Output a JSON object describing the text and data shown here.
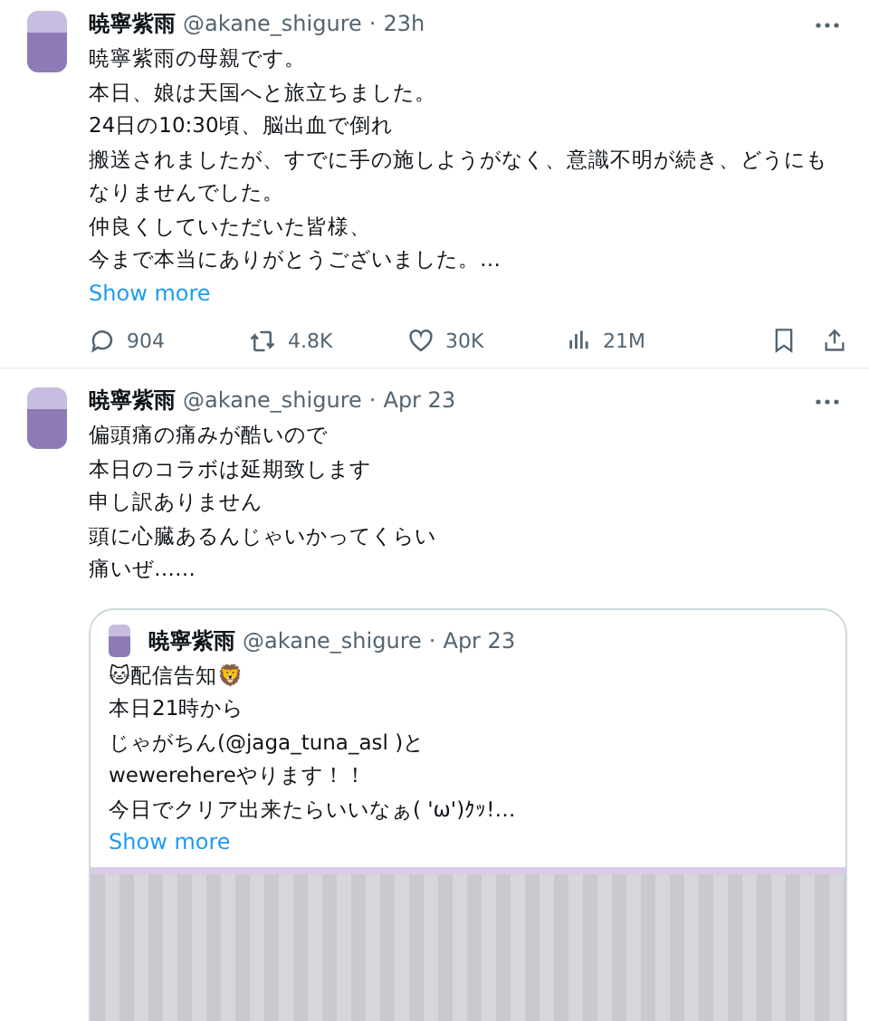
{
  "tweets": [
    {
      "name": "暁寧紫雨",
      "handle": "@akane_shigure",
      "separator": "·",
      "time": "23h",
      "lines": [
        "暁寧紫雨の母親です。",
        "本日、娘は天国へと旅立ちました。",
        "24日の10:30頃、脳出血で倒れ",
        "搬送されましたが、すでに手の施しようがなく、意識不明が続き、どうにもなりませんでした。",
        "仲良くしていただいた皆様、",
        "今まで本当にありがとうございました。…"
      ],
      "show_more": "Show more",
      "stats": {
        "replies": "904",
        "retweets": "4.8K",
        "likes": "30K",
        "views": "21M"
      }
    },
    {
      "name": "暁寧紫雨",
      "handle": "@akane_shigure",
      "separator": "·",
      "time": "Apr 23",
      "lines": [
        "偏頭痛の痛みが酷いので",
        "本日のコラボは延期致します",
        "申し訳ありません",
        "頭に心臓あるんじゃいかってくらい",
        "痛いぜ……"
      ],
      "quote": {
        "name": "暁寧紫雨",
        "handle": "@akane_shigure",
        "separator": "·",
        "time": "Apr 23",
        "lines": [
          "🐱配信告知🦁",
          "本日21時から",
          "じゃがちん(@jaga_tuna_asl )と",
          "wewerehereやります！！",
          "今日でクリア出来たらいいなぁ( 'ω')ｸｯ!…"
        ],
        "show_more": "Show more"
      }
    }
  ]
}
